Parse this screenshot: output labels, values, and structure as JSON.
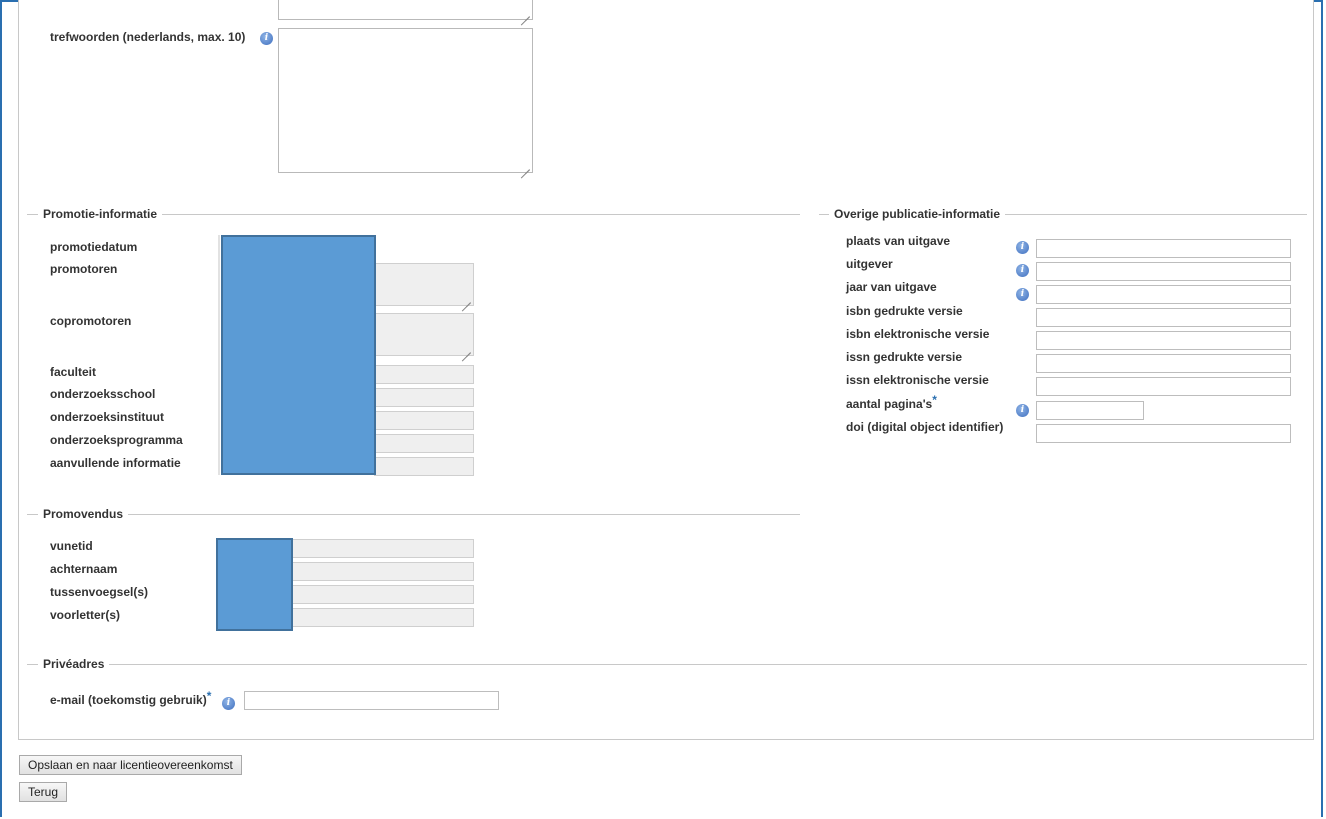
{
  "keywords_section": {
    "keywords_nl_label": "trefwoorden (nederlands, max. 10)"
  },
  "promotion": {
    "legend": "Promotie-informatie",
    "fields": {
      "date": "promotiedatum",
      "promotors": "promotoren",
      "copromotors": "copromotoren",
      "faculty": "faculteit",
      "research_school": "onderzoeksschool",
      "research_institute": "onderzoeksinstituut",
      "research_program": "onderzoeksprogramma",
      "additional_info": "aanvullende informatie"
    }
  },
  "other_publication": {
    "legend": "Overige publicatie-informatie",
    "fields": {
      "place": "plaats van uitgave",
      "publisher": "uitgever",
      "year": "jaar van uitgave",
      "isbn_print": "isbn gedrukte versie",
      "isbn_electronic": "isbn elektronische versie",
      "issn_print": "issn gedrukte versie",
      "issn_electronic": "issn elektronische versie",
      "pages": "aantal pagina's",
      "doi": "doi (digital object identifier)"
    },
    "required_marker": "*"
  },
  "candidate": {
    "legend": "Promovendus",
    "fields": {
      "vunetid": "vunetid",
      "surname": "achternaam",
      "infix": "tussenvoegsel(s)",
      "initials": "voorletter(s)"
    }
  },
  "private_address": {
    "legend": "Privéadres",
    "email_label": "e-mail (toekomstig gebruik)",
    "required_marker": "*"
  },
  "buttons": {
    "save_to_license": "Opslaan en naar licentieovereenkomst",
    "back": "Terug"
  },
  "icons": {
    "info": "info-icon",
    "info_glyph": "i"
  },
  "colors": {
    "redaction": "#5b9bd5",
    "frame": "#2a6fb0"
  }
}
